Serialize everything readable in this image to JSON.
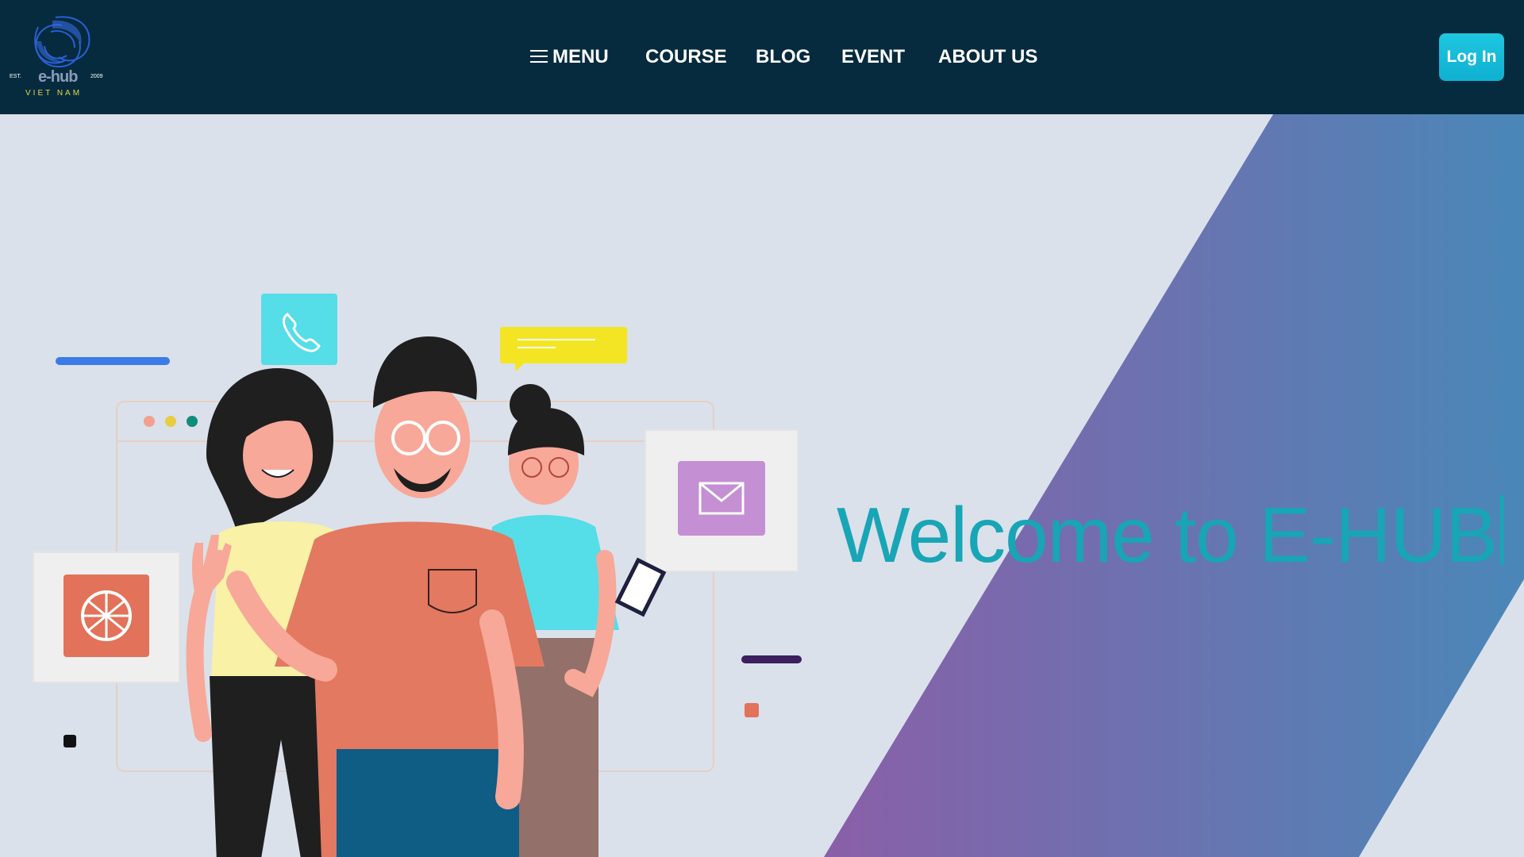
{
  "logo": {
    "est_left": "EST.",
    "est_right": "2009",
    "brand": "e-hub",
    "country": "VIET NAM",
    "icon": "swirl-logo"
  },
  "nav": {
    "menu_label": "MENU",
    "menu_icon": "hamburger-icon",
    "items": [
      "COURSE",
      "BLOG",
      "EVENT",
      "ABOUT US"
    ]
  },
  "login_label": "Log In",
  "hero": {
    "headline": "Welcome to E-HUB",
    "illustration_icons": [
      "phone-icon",
      "chat-bubble-icon",
      "mail-icon",
      "globe-icon",
      "mobile-phone-icon"
    ]
  },
  "colors": {
    "header_bg": "#062b3e",
    "page_bg": "#dae1ea",
    "accent": "#18a5b6",
    "stripe_start": "#8a5fa8",
    "stripe_end": "#4a87b8"
  }
}
